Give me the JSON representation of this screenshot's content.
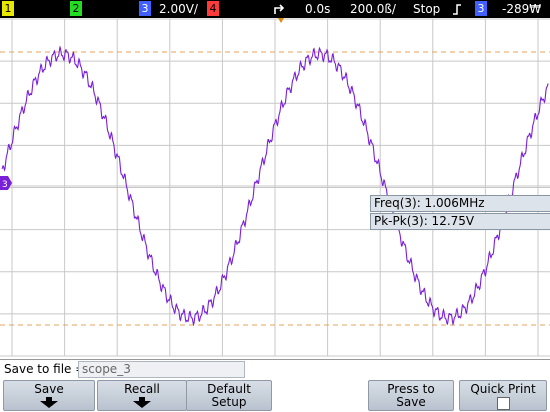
{
  "status": {
    "channels": [
      {
        "label": "1",
        "color": "#e8e800"
      },
      {
        "label": "2",
        "color": "#22dd22"
      },
      {
        "label": "3",
        "color": "#4060ff"
      },
      {
        "label": "4",
        "color": "#ff3a3a"
      }
    ],
    "scale": "2.00V/",
    "time_offset": "0.0s",
    "time_scale": "200.0ß/",
    "run_state": "Stop",
    "trigger_channel": "3",
    "trigger_level": "-289₩"
  },
  "waveform": {
    "channel_marker": "3",
    "color": "#7a1fd8",
    "cycles_visible": 2.1,
    "amplitude_v": 12.75
  },
  "measurements": {
    "freq": "Freq(3): 1.006MHz",
    "pkpk": "Pk-Pk(3): 12.75V"
  },
  "save": {
    "label": "Save to file =",
    "filename": "scope_3"
  },
  "softkeys": {
    "save": "Save",
    "recall": "Recall",
    "default_1": "Default",
    "default_2": "Setup",
    "press_1": "Press to",
    "press_2": "Save",
    "quick_print": "Quick Print"
  }
}
